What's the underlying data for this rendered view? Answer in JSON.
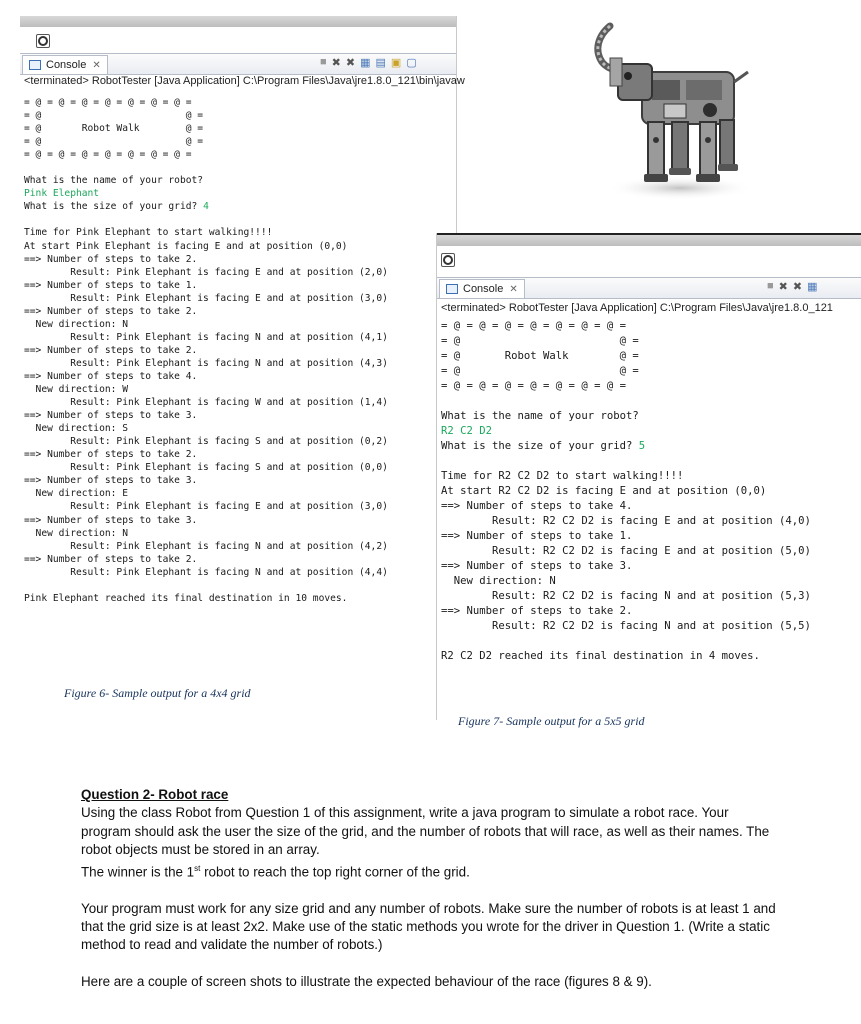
{
  "figure6": {
    "tab_label": "Console",
    "terminated": "<terminated> RobotTester [Java Application] C:\\Program Files\\Java\\jre1.8.0_121\\bin\\javaw",
    "lines": [
      {
        "t": "= @ = @ = @ = @ = @ = @ = @ ="
      },
      {
        "t": "= @                         @ ="
      },
      {
        "t": "= @       Robot Walk        @ ="
      },
      {
        "t": "= @                         @ ="
      },
      {
        "t": "= @ = @ = @ = @ = @ = @ = @ ="
      },
      {
        "t": ""
      },
      {
        "t": "What is the name of your robot?"
      },
      {
        "t": "Pink Elephant",
        "input": true
      },
      {
        "t": "What is the size of your grid? ",
        "input_tail": "4"
      },
      {
        "t": ""
      },
      {
        "t": "Time for Pink Elephant to start walking!!!!"
      },
      {
        "t": "At start Pink Elephant is facing E and at position (0,0)"
      },
      {
        "t": "==> Number of steps to take 2."
      },
      {
        "t": "        Result: Pink Elephant is facing E and at position (2,0)"
      },
      {
        "t": "==> Number of steps to take 1."
      },
      {
        "t": "        Result: Pink Elephant is facing E and at position (3,0)"
      },
      {
        "t": "==> Number of steps to take 2."
      },
      {
        "t": "  New direction: N"
      },
      {
        "t": "        Result: Pink Elephant is facing N and at position (4,1)"
      },
      {
        "t": "==> Number of steps to take 2."
      },
      {
        "t": "        Result: Pink Elephant is facing N and at position (4,3)"
      },
      {
        "t": "==> Number of steps to take 4."
      },
      {
        "t": "  New direction: W"
      },
      {
        "t": "        Result: Pink Elephant is facing W and at position (1,4)"
      },
      {
        "t": "==> Number of steps to take 3."
      },
      {
        "t": "  New direction: S"
      },
      {
        "t": "        Result: Pink Elephant is facing S and at position (0,2)"
      },
      {
        "t": "==> Number of steps to take 2."
      },
      {
        "t": "        Result: Pink Elephant is facing S and at position (0,0)"
      },
      {
        "t": "==> Number of steps to take 3."
      },
      {
        "t": "  New direction: E"
      },
      {
        "t": "        Result: Pink Elephant is facing E and at position (3,0)"
      },
      {
        "t": "==> Number of steps to take 3."
      },
      {
        "t": "  New direction: N"
      },
      {
        "t": "        Result: Pink Elephant is facing N and at position (4,2)"
      },
      {
        "t": "==> Number of steps to take 2."
      },
      {
        "t": "        Result: Pink Elephant is facing N and at position (4,4)"
      },
      {
        "t": ""
      },
      {
        "t": "Pink Elephant reached its final destination in 10 moves."
      }
    ],
    "caption": "Figure 6- Sample output for a 4x4 grid"
  },
  "figure7": {
    "tab_label": "Console",
    "terminated": "<terminated> RobotTester [Java Application] C:\\Program Files\\Java\\jre1.8.0_121",
    "lines": [
      {
        "t": "= @ = @ = @ = @ = @ = @ = @ ="
      },
      {
        "t": "= @                         @ ="
      },
      {
        "t": "= @       Robot Walk        @ ="
      },
      {
        "t": "= @                         @ ="
      },
      {
        "t": "= @ = @ = @ = @ = @ = @ = @ ="
      },
      {
        "t": ""
      },
      {
        "t": "What is the name of your robot?"
      },
      {
        "t": "R2 C2 D2",
        "input": true
      },
      {
        "t": "What is the size of your grid? ",
        "input_tail": "5"
      },
      {
        "t": ""
      },
      {
        "t": "Time for R2 C2 D2 to start walking!!!!"
      },
      {
        "t": "At start R2 C2 D2 is facing E and at position (0,0)"
      },
      {
        "t": "==> Number of steps to take 4."
      },
      {
        "t": "        Result: R2 C2 D2 is facing E and at position (4,0)"
      },
      {
        "t": "==> Number of steps to take 1."
      },
      {
        "t": "        Result: R2 C2 D2 is facing E and at position (5,0)"
      },
      {
        "t": "==> Number of steps to take 3."
      },
      {
        "t": "  New direction: N"
      },
      {
        "t": "        Result: R2 C2 D2 is facing N and at position (5,3)"
      },
      {
        "t": "==> Number of steps to take 2."
      },
      {
        "t": "        Result: R2 C2 D2 is facing N and at position (5,5)"
      },
      {
        "t": ""
      },
      {
        "t": "R2 C2 D2 reached its final destination in 4 moves."
      }
    ],
    "caption": "Figure 7- Sample output for a 5x5 grid"
  },
  "question2": {
    "heading": "Question 2- Robot race",
    "p1": "Using the class Robot from Question 1 of this assignment, write a java program to simulate a robot race. Your program should ask the user the size of the grid, and the number of robots that will race, as well as their names. The robot objects must be stored in an array.",
    "p1b_before": "The winner is the 1",
    "p1b_sup": "st",
    "p1b_after": " robot to reach the top right corner of the grid.",
    "p2": "Your program must work for any size grid and any number of robots. Make sure the number of robots is at least 1 and that the grid size is at least 2x2. Make use of the static methods you wrote for the driver in Question 1. (Write a static method to read and validate the number of robots.)",
    "p3": "Here are a couple of screen shots to illustrate the expected behaviour of the race (figures 8 & 9)."
  },
  "colors": {
    "input_text": "#1ba85b",
    "caption": "#16325c"
  }
}
